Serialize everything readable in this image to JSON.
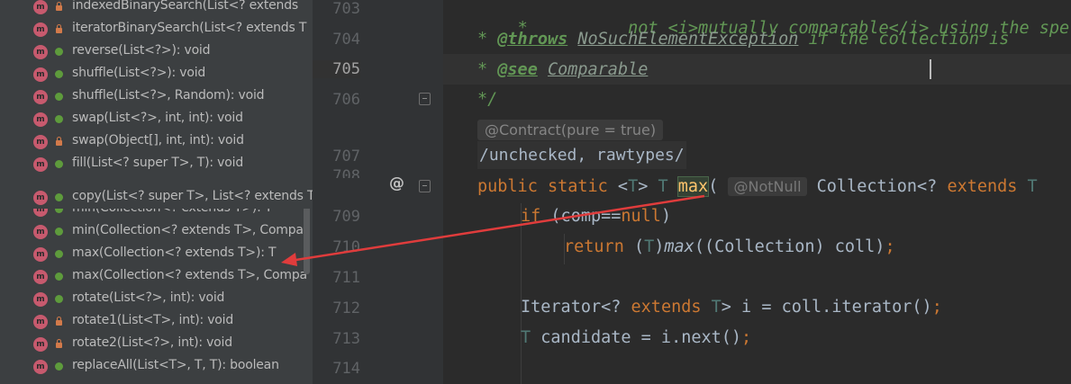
{
  "structure": {
    "overflow_label": "copy(List<? super T>, List<? extends T>): void",
    "items": [
      {
        "label": "indexedBinarySearch(List<? extends",
        "visibility": "private"
      },
      {
        "label": "iteratorBinarySearch(List<? extends T",
        "visibility": "private"
      },
      {
        "label": "reverse(List<?>): void",
        "visibility": "public"
      },
      {
        "label": "shuffle(List<?>): void",
        "visibility": "public"
      },
      {
        "label": "shuffle(List<?>, Random): void",
        "visibility": "public"
      },
      {
        "label": "swap(List<?>, int, int): void",
        "visibility": "public"
      },
      {
        "label": "swap(Object[], int, int): void",
        "visibility": "private"
      },
      {
        "label": "fill(List<? super T>, T): void",
        "visibility": "public"
      },
      {
        "label": "copy(List<? super T>, List<? extends T>): void",
        "visibility": "public"
      },
      {
        "label": "min(Collection<? extends T>): T",
        "visibility": "public"
      },
      {
        "label": "min(Collection<? extends T>, Compa",
        "visibility": "public"
      },
      {
        "label": "max(Collection<? extends T>): T",
        "visibility": "public"
      },
      {
        "label": "max(Collection<? extends T>, Compa",
        "visibility": "public"
      },
      {
        "label": "rotate(List<?>, int): void",
        "visibility": "public"
      },
      {
        "label": "rotate1(List<T>, int): void",
        "visibility": "private"
      },
      {
        "label": "rotate2(List<?>, int): void",
        "visibility": "private"
      },
      {
        "label": "replaceAll(List<T>, T, T): boolean",
        "visibility": "public"
      }
    ],
    "method_icon_letter": "m"
  },
  "editor": {
    "line_numbers": {
      "l703": "703",
      "l704": "704",
      "l705": "705",
      "l706": "706",
      "l707": "707",
      "l708": "708",
      "l709": "709",
      "l710": "710",
      "l711": "711",
      "l712": "712",
      "l713": "713",
      "l714": "714"
    },
    "gutter_marker": "@",
    "inlay_contract": "@Contract(pure = true)",
    "inlay_notnull": "@NotNull",
    "suppress_line": "/unchecked, rawtypes/",
    "code": {
      "l703_star": "*",
      "l703_text": "not <i>mutually comparable</i> using the spe",
      "l704_star": "* ",
      "l704_tag": "@throws",
      "l704_ref": "NoSuchElementException",
      "l704_text": " if the collection is",
      "l705_star": "* ",
      "l705_tag": "@see",
      "l705_ref": "Comparable",
      "l706": "*/",
      "l708_public": "public static",
      "l708_lt": " <",
      "l708_T1": "T",
      "l708_gt": "> ",
      "l708_T2": "T",
      "l708_max": "max",
      "l708_paren": "(",
      "l708_coll": "Collection<? ",
      "l708_extends": "extends",
      "l708_T3": " T",
      "l709_if": "if",
      "l709_open": " (comp==",
      "l709_null": "null",
      "l709_close": ")",
      "l710_return": "return",
      "l710_cast_open": " (",
      "l710_T": "T",
      "l710_cast_close": ")",
      "l710_max": "max",
      "l710_rest": "((Collection) coll)",
      "l710_semi": ";",
      "l712_iter": "Iterator<? ",
      "l712_extends": "extends",
      "l712_T": " T",
      "l712_rest": "> i = coll.iterator()",
      "l712_semi": ";",
      "l713_T": "T",
      "l713_rest": " candidate = i.next()",
      "l713_semi": ";"
    }
  },
  "colors": {
    "annotation_arrow": "#e03c3c",
    "keyword": "#cc7832",
    "doc_comment": "#629755",
    "method_icon": "#c75a6e"
  }
}
